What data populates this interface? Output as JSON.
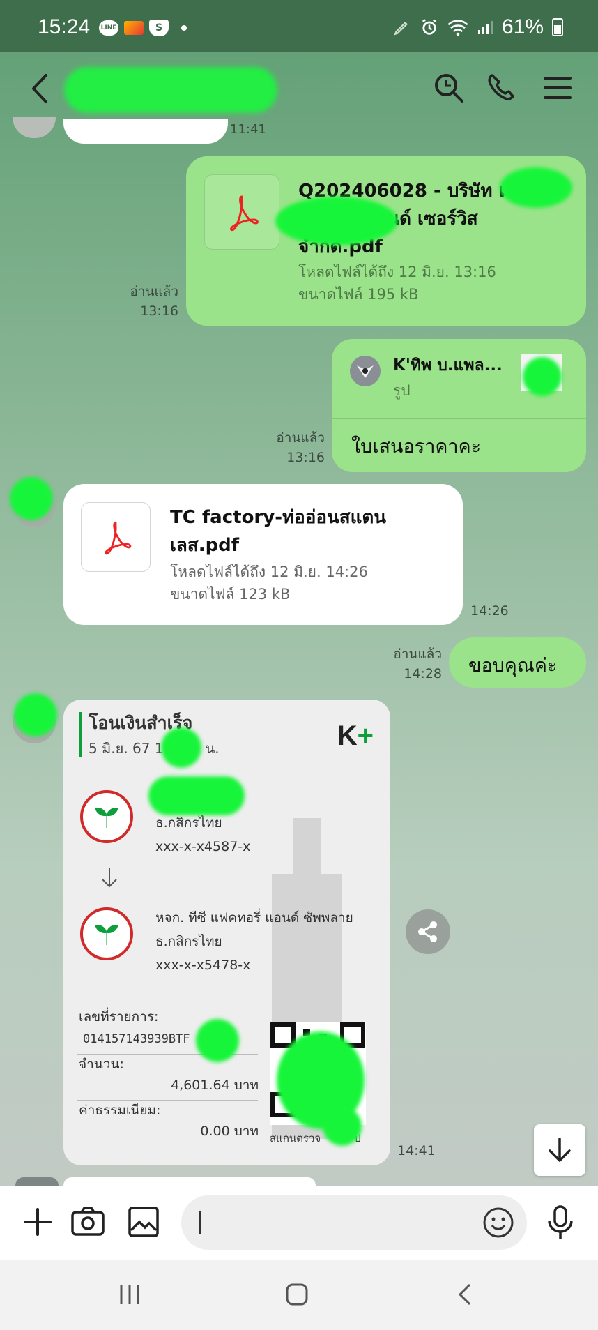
{
  "status_bar": {
    "time": "15:24",
    "battery": "61%",
    "line_badge": "LINE",
    "s_badge": "S"
  },
  "chat": {
    "partial_top_time": "11:41",
    "messages": [
      {
        "type": "file_out",
        "filename": "Q202406028 - บริษัท เ... ...ยริ่ง แอนด์ เซอร์วิส จำกัด.pdf",
        "filename_line1": "Q202406028 - บริษัท เ",
        "filename_line2": "ยริ่ง แอนด์ เซอร์วิส",
        "filename_line3": "จำกัด.pdf",
        "download_until": "โหลดไฟล์ได้ถึง 12 มิ.ย. 13:16",
        "size": "ขนาดไฟล์ 195 kB",
        "read": "อ่านแล้ว",
        "time": "13:16"
      },
      {
        "type": "reply_out",
        "reply_name": "K'ทิพ บ.แพล...",
        "reply_kind": "รูป",
        "text": "ใบเสนอราคาคะ",
        "read": "อ่านแล้ว",
        "time": "13:16"
      },
      {
        "type": "file_in",
        "filename_line1": "TC factory-ท่ออ่อนสแตน",
        "filename_line2": "เลส.pdf",
        "download_until": "โหลดไฟล์ได้ถึง 12 มิ.ย. 14:26",
        "size": "ขนาดไฟล์ 123 kB",
        "time": "14:26"
      },
      {
        "type": "text_out",
        "text": "ขอบคุณค่ะ",
        "read": "อ่านแล้ว",
        "time": "14:28"
      },
      {
        "type": "image_in",
        "time": "14:41",
        "receipt": {
          "title": "โอนเงินสำเร็จ",
          "date": "5 มิ.ย. 67  1",
          "date_tail": "น.",
          "brand": "K",
          "brand_plus": "+",
          "from_bank": "ธ.กสิกรไทย",
          "from_account": "xxx-x-x4587-x",
          "to_name": "หจก. ทีซี แฟคทอรี่ แอนด์ ซัพพลาย",
          "to_bank": "ธ.กสิกรไทย",
          "to_account": "xxx-x-x5478-x",
          "ref_label": "เลขที่รายการ:",
          "ref_value": "014157143939BTF",
          "amount_label": "จำนวน:",
          "amount_value": "4,601.64 บาท",
          "fee_label": "ค่าธรรมเนียม:",
          "fee_value": "0.00 บาท",
          "qr_caption": "สแกนตรวจ",
          "qr_caption_tail": "ป"
        }
      }
    ]
  },
  "input": {
    "placeholder": ""
  },
  "colors": {
    "accent_green": "#9be38a",
    "header_green": "#3e6e4c",
    "kbank_green": "#0c9f3c"
  },
  "icons": [
    "back-icon",
    "search-icon",
    "phone-icon",
    "menu-icon",
    "plus-icon",
    "camera-icon",
    "image-icon",
    "emoji-icon",
    "mic-icon",
    "share-icon",
    "scroll-down-icon",
    "pdf-icon"
  ]
}
